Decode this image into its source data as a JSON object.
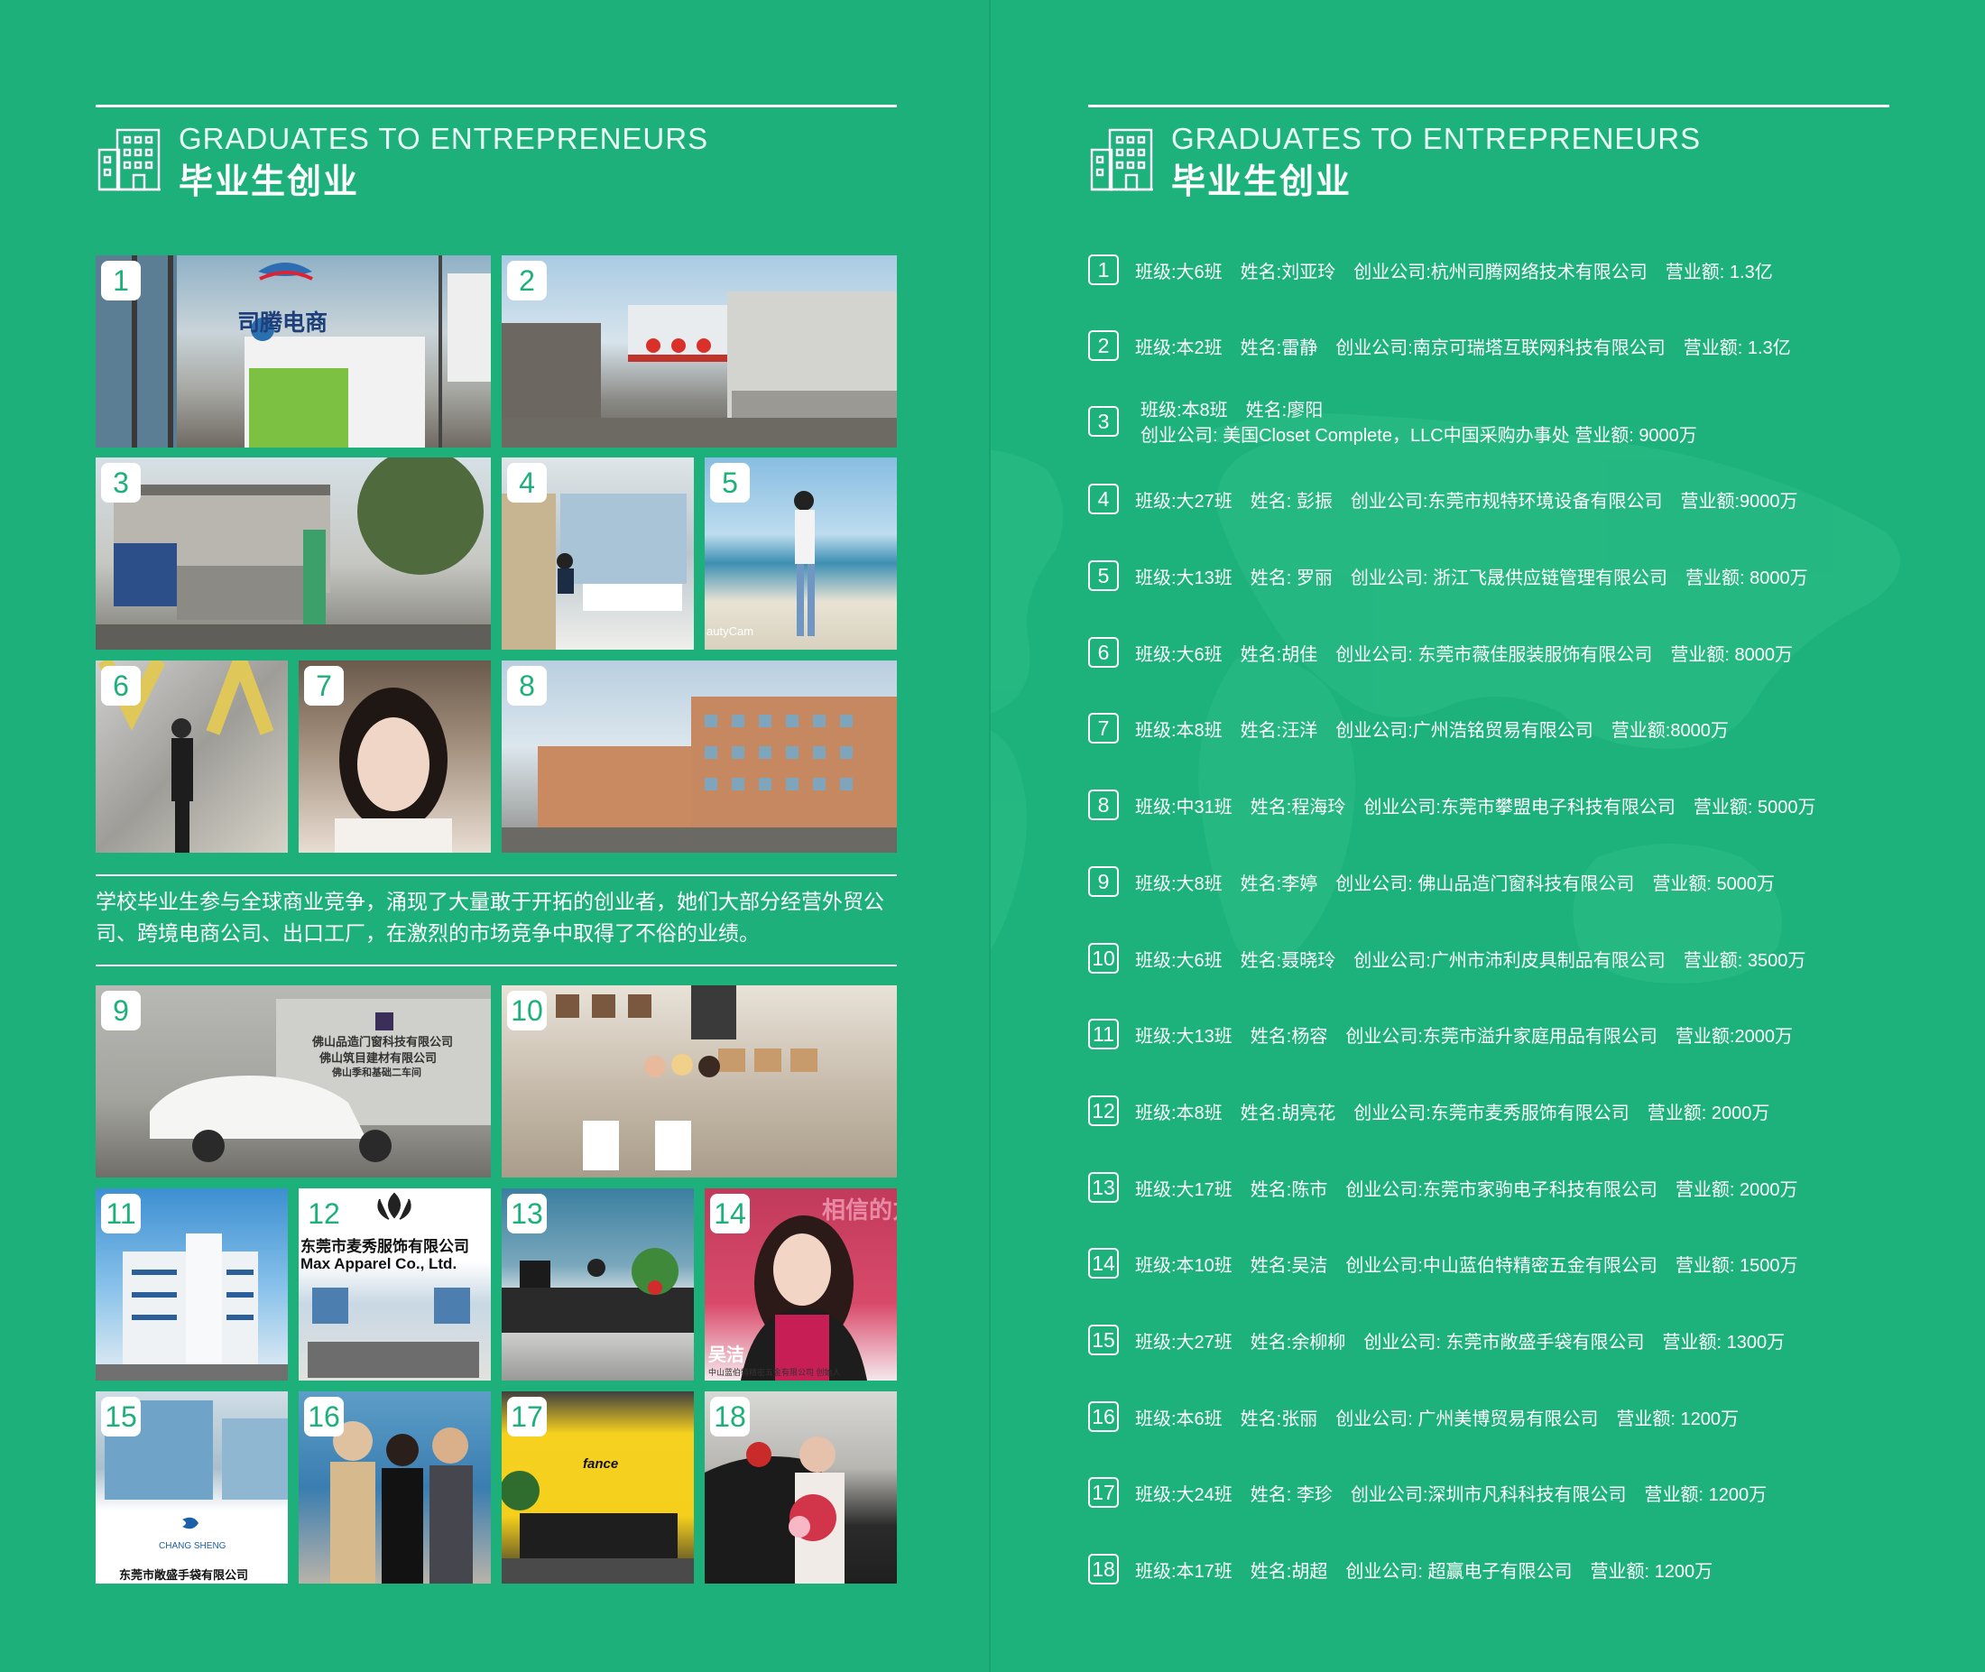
{
  "header": {
    "en": "GRADUATES TO ENTREPRENEURS",
    "cn": "毕业生创业"
  },
  "intro": "学校毕业生参与全球商业竞争，涌现了大量敢于开拓的创业者，她们大部分经营外贸公司、跨境电商公司、出口工厂，在激烈的市场竞争中取得了不俗的业绩。",
  "photos": [
    {
      "num": "1",
      "scene": "司腾电商 office reception",
      "sign": "司腾电商"
    },
    {
      "num": "2",
      "scene": "factory gate with red lanterns"
    },
    {
      "num": "3",
      "scene": "company courtyard with trucks"
    },
    {
      "num": "4",
      "scene": "office desk by window"
    },
    {
      "num": "5",
      "scene": "woman on beach",
      "sign": "autyCam"
    },
    {
      "num": "6",
      "scene": "woman in front of letters"
    },
    {
      "num": "7",
      "scene": "portrait"
    },
    {
      "num": "8",
      "scene": "factory building"
    },
    {
      "num": "9",
      "scene": "car by company sign",
      "sign": "佛山品造门窗科技有限公司",
      "sign2": "佛山筑目建材有限公司",
      "sign3": "佛山季和基础二车间"
    },
    {
      "num": "10",
      "scene": "handbag showroom"
    },
    {
      "num": "11",
      "scene": "office tower"
    },
    {
      "num": "12",
      "scene": "Max Apparel office",
      "sign": "东莞市麦秀服饰有限公司",
      "sign2": "Max Apparel Co., Ltd."
    },
    {
      "num": "13",
      "scene": "office with plants"
    },
    {
      "num": "14",
      "scene": "woman portrait poster",
      "sign": "吴洁",
      "sign2": "中山蓝伯特精密五金有限公司 创始人",
      "sign3": "相信的力量"
    },
    {
      "num": "15",
      "scene": "factory buildings",
      "sign": "CHANG SHENG",
      "sign2": "东莞市敞盛手袋有限公司"
    },
    {
      "num": "16",
      "scene": "group of three people"
    },
    {
      "num": "17",
      "scene": "yellow reception wall",
      "sign": "fance"
    },
    {
      "num": "18",
      "scene": "woman with flowers by car"
    }
  ],
  "list": [
    {
      "num": "1",
      "text": "班级:大6班　姓名:刘亚玲　创业公司:杭州司腾网络技术有限公司　营业额: 1.3亿"
    },
    {
      "num": "2",
      "text": "班级:本2班　姓名:雷静　创业公司:南京可瑞塔互联网科技有限公司　营业额: 1.3亿"
    },
    {
      "num": "3",
      "line1": "班级:本8班　姓名:廖阳",
      "line2": "创业公司: 美国Closet Complete，LLC中国采购办事处  营业额: 9000万"
    },
    {
      "num": "4",
      "text": "班级:大27班　姓名: 彭振　创业公司:东莞市规特环境设备有限公司　营业额:9000万"
    },
    {
      "num": "5",
      "text": "班级:大13班　姓名: 罗丽　创业公司: 浙江飞晟供应链管理有限公司　营业额: 8000万"
    },
    {
      "num": "6",
      "text": "班级:大6班　姓名:胡佳　创业公司: 东莞市薇佳服装服饰有限公司　营业额: 8000万"
    },
    {
      "num": "7",
      "text": "班级:本8班　姓名:汪洋　创业公司:广州浩铭贸易有限公司　营业额:8000万"
    },
    {
      "num": "8",
      "text": "班级:中31班　姓名:程海玲　创业公司:东莞市攀盟电子科技有限公司　营业额: 5000万"
    },
    {
      "num": "9",
      "text": "班级:大8班　姓名:李婷　创业公司: 佛山品造门窗科技有限公司　营业额: 5000万"
    },
    {
      "num": "10",
      "text": "班级:大6班　姓名:聂晓玲　创业公司:广州市沛利皮具制品有限公司　营业额: 3500万"
    },
    {
      "num": "11",
      "text": "班级:大13班　姓名:杨容　创业公司:东莞市溢升家庭用品有限公司　营业额:2000万"
    },
    {
      "num": "12",
      "text": "班级:本8班　姓名:胡亮花　创业公司:东莞市麦秀服饰有限公司　营业额: 2000万"
    },
    {
      "num": "13",
      "text": "班级:大17班　姓名:陈市　创业公司:东莞市家驹电子科技有限公司　营业额: 2000万"
    },
    {
      "num": "14",
      "text": "班级:本10班　姓名:吴洁　创业公司:中山蓝伯特精密五金有限公司　营业额: 1500万"
    },
    {
      "num": "15",
      "text": "班级:大27班　姓名:余柳柳　创业公司: 东莞市敞盛手袋有限公司　营业额: 1300万"
    },
    {
      "num": "16",
      "text": "班级:本6班　姓名:张丽　创业公司: 广州美博贸易有限公司　营业额: 1200万"
    },
    {
      "num": "17",
      "text": "班级:大24班　姓名: 李珍　创业公司:深圳市凡科科技有限公司　营业额: 1200万"
    },
    {
      "num": "18",
      "text": "班级:本17班　姓名:胡超　创业公司: 超赢电子有限公司　营业额: 1200万"
    }
  ],
  "colors": {
    "background": "#1db27a",
    "accent_text": "#1db07a",
    "text": "#ffffff"
  }
}
